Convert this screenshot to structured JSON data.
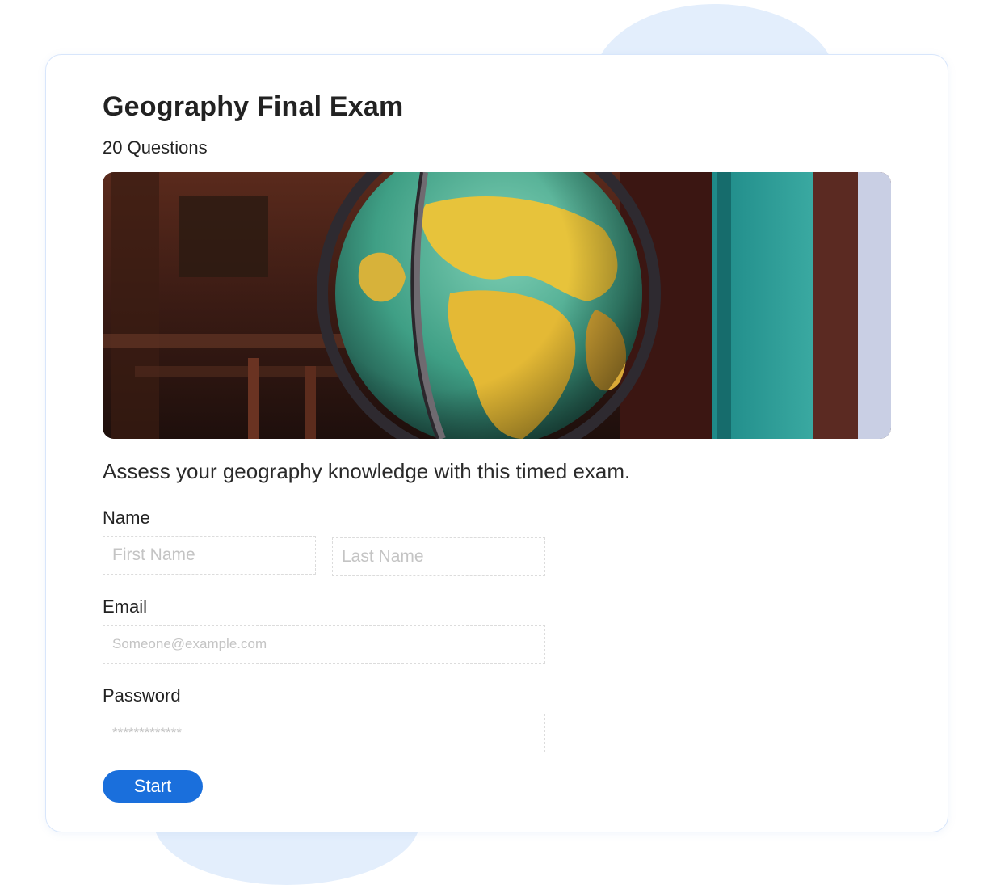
{
  "exam": {
    "title": "Geography Final Exam",
    "question_count": "20 Questions",
    "description": "Assess your geography knowledge with this timed exam."
  },
  "banner": {
    "image": "globe-in-classroom-photo"
  },
  "form": {
    "name_label": "Name",
    "first_name_placeholder": "First Name",
    "last_name_placeholder": "Last Name",
    "email_label": "Email",
    "email_placeholder": "Someone@example.com",
    "password_label": "Password",
    "password_placeholder": "*************",
    "start_label": "Start"
  },
  "colors": {
    "accent": "#1a6fdc",
    "background_blob": "#e3eefc",
    "card_border": "#d8e6fb"
  }
}
